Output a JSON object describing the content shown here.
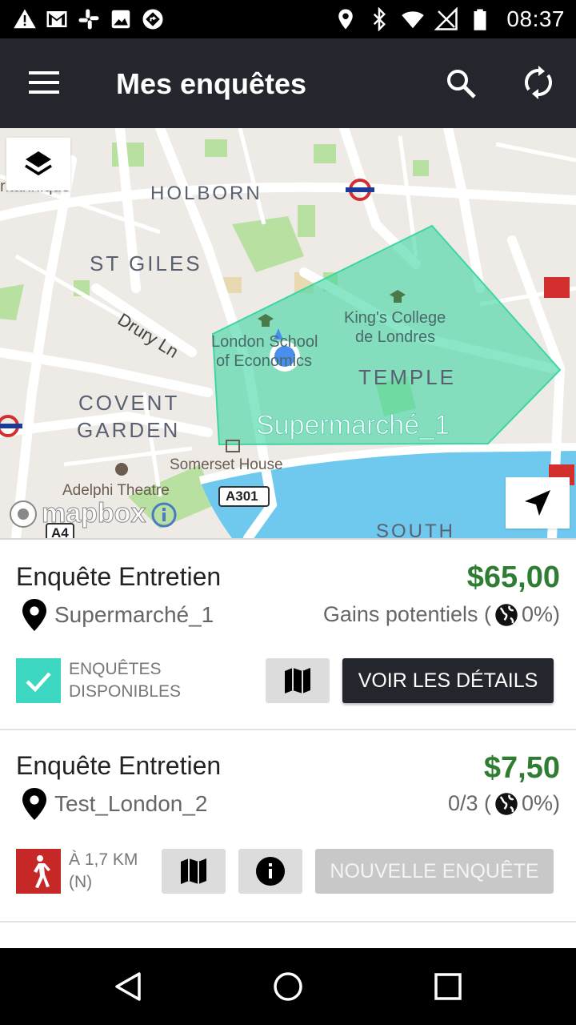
{
  "status_bar": {
    "time": "08:37",
    "left_icons": [
      "warning-icon",
      "gmail-icon",
      "slack-icon",
      "image-icon",
      "navigation-diamond-icon"
    ],
    "right_icons": [
      "location-icon",
      "bluetooth-icon",
      "wifi-icon",
      "no-signal-icon",
      "battery-icon"
    ]
  },
  "app_bar": {
    "title": "Mes enquêtes",
    "icons": [
      "menu-icon",
      "search-icon",
      "refresh-icon"
    ]
  },
  "map": {
    "labels": {
      "britannique": "ritannique",
      "holborn": "HOLBORN",
      "st_giles": "ST GILES",
      "drury_ln": "Drury Ln",
      "lse": "London School",
      "lse2": "of Economics",
      "kings": "King's College",
      "kings2": "de Londres",
      "temple": "TEMPLE",
      "covent": "COVENT",
      "garden": "GARDEN",
      "somerset": "Somerset House",
      "adelphi": "Adelphi Theatre",
      "a301": "A301",
      "a4": "A4",
      "south": "SOUTH"
    },
    "zone_label": "Supermarché_1",
    "attribution": "mapbox",
    "colors": {
      "zone": "#3dd6a3",
      "water": "#6fc9ef",
      "park": "#b8e0a0"
    }
  },
  "cards": [
    {
      "title": "Enquête Entretien",
      "price": "$65,00",
      "location": "Supermarché_1",
      "meta_prefix": "Gains potentiels (",
      "meta_suffix": "0%)",
      "status_line1": "ENQUÊTES",
      "status_line2": "DISPONIBLES",
      "status_color": "#3dd6c0",
      "primary_button": "VOIR LES DÉTAILS"
    },
    {
      "title": "Enquête Entretien",
      "price": "$7,50",
      "location": "Test_London_2",
      "meta_prefix": "0/3 (",
      "meta_suffix": "0%)",
      "status_line1": "À 1,7 KM",
      "status_line2": "(N)",
      "status_color": "#c62828",
      "primary_button": "NOUVELLE ENQUÊTE"
    }
  ],
  "nav_bar": {
    "icons": [
      "back-icon",
      "home-icon",
      "recents-icon"
    ]
  }
}
